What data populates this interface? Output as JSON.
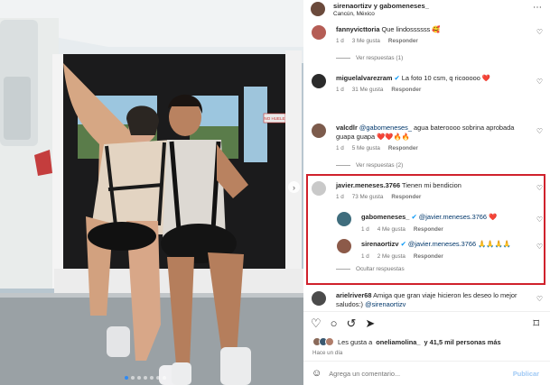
{
  "post": {
    "author": "sirenaortizv y gabomeneses_",
    "location": "Cancún, México",
    "options_icon": "more-icon"
  },
  "comments": [
    {
      "user": "fannyvicttoria",
      "text": "Que lindossssss 🥰",
      "time": "1 d",
      "likes": "3 Me gusta",
      "reply": "Responder",
      "view_replies": "Ver respuestas (1)"
    },
    {
      "user": "miguelalvarezram",
      "text": "La foto 10 csm, q ricooooo ❤️",
      "time": "1 d",
      "likes": "31 Me gusta",
      "reply": "Responder"
    },
    {
      "user": "valcdlr",
      "mention": "@gabomeneses_",
      "text": " agua bateroooo sobrina aprobada guapa guapa ❤️❤️🔥🔥",
      "time": "1 d",
      "likes": "5 Me gusta",
      "reply": "Responder",
      "view_replies": "Ver respuestas (2)"
    },
    {
      "user": "javier.meneses.3766",
      "text": "Tienen mi bendicion",
      "time": "1 d",
      "likes": "73 Me gusta",
      "reply": "Responder"
    },
    {
      "user": "arielriver68",
      "text": "Amiga que gran viaje hicieron les deseo lo mejor saludos:)",
      "mention": "@sirenaortizv"
    }
  ],
  "replies": [
    {
      "user": "gabomeneses_",
      "mention": "@javier.meneses.3766",
      "text": "❤️",
      "time": "1 d",
      "likes": "4 Me gusta",
      "reply": "Responder"
    },
    {
      "user": "sirenaortizv",
      "mention": "@javier.meneses.3766",
      "text": "🙏🙏🙏🙏",
      "time": "1 d",
      "likes": "2 Me gusta",
      "reply": "Responder"
    }
  ],
  "hide_replies": "Ocultar respuestas",
  "likes": {
    "prefix": "Les gusta a",
    "user": "oneliamolina_",
    "suffix": "y 41,5 mil personas más"
  },
  "time_ago": "Hace un día",
  "add_comment": {
    "placeholder": "Agrega un comentario...",
    "publish": "Publicar"
  },
  "photo": {
    "sign": "NO HUELE"
  },
  "colors": {
    "highlight": "#d0212c",
    "link": "#00376b",
    "verified": "#0095f6",
    "publish": "#9fc9f5"
  }
}
